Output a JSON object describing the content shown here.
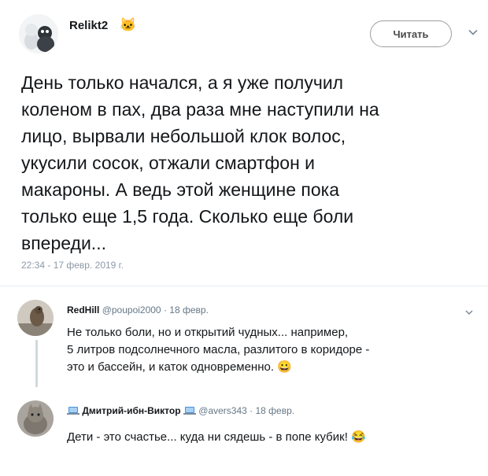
{
  "header": {
    "author_name": "Relikt2",
    "author_emoji": "🐱",
    "follow_label": "Читать"
  },
  "tweet": {
    "lines": [
      "День только начался, а я уже получил",
      "коленом в пах, два раза мне наступили на",
      "лицо, вырвали небольшой клок волос,",
      "укусили сосок, отжали смартфон и",
      "макароны. А ведь этой женщине пока",
      "только еще 1,5 года. Сколько еще боли",
      "впереди..."
    ],
    "timestamp": "22:34 - 17 февр. 2019 г."
  },
  "replies": [
    {
      "name": "RedHill",
      "handle": "@poupoi2000",
      "sep": "·",
      "date": "18 февр.",
      "lines": [
        "Не только боли, но и открытий чудных... например,",
        "5 литров подсолнечного масла, разлитого в коридоре -",
        "это и бассейн, и каток одновременно. 😀"
      ]
    },
    {
      "name": "Дмитрий-ибн-Виктор",
      "handle": "@avers343",
      "sep": "·",
      "date": "18 февр.",
      "lines": [
        "Дети - это счастье... куда ни сядешь - в попе кубик! 😂"
      ]
    }
  ],
  "icons": {
    "menu": "chevron-down-icon",
    "laptop": "laptop-icon"
  },
  "colors": {
    "meta_gray": "#657786",
    "timestamp_gray": "#8c99a6",
    "thread_line": "#cfd9de"
  }
}
